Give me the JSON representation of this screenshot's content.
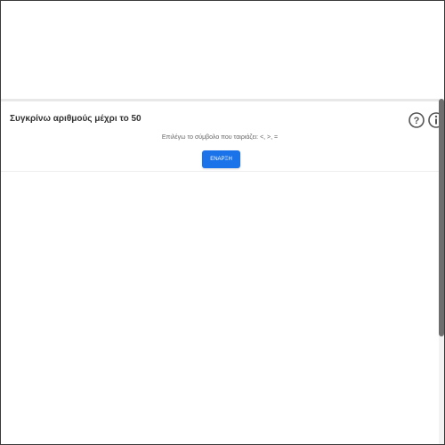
{
  "activity": {
    "title": "Συγκρίνω αριθμούς μέχρι το 50",
    "subtitle": "Επιλέγω το σύμβολο που ταιριάζει: <, >, =",
    "start_label": "ΕΝΑΡΞΗ"
  },
  "icons": {
    "help": "help-circle-icon",
    "info": "info-circle-icon"
  },
  "colors": {
    "accent": "#1a73e8",
    "title_text": "#333333",
    "subtitle_text": "#666666",
    "icon": "#555555"
  }
}
